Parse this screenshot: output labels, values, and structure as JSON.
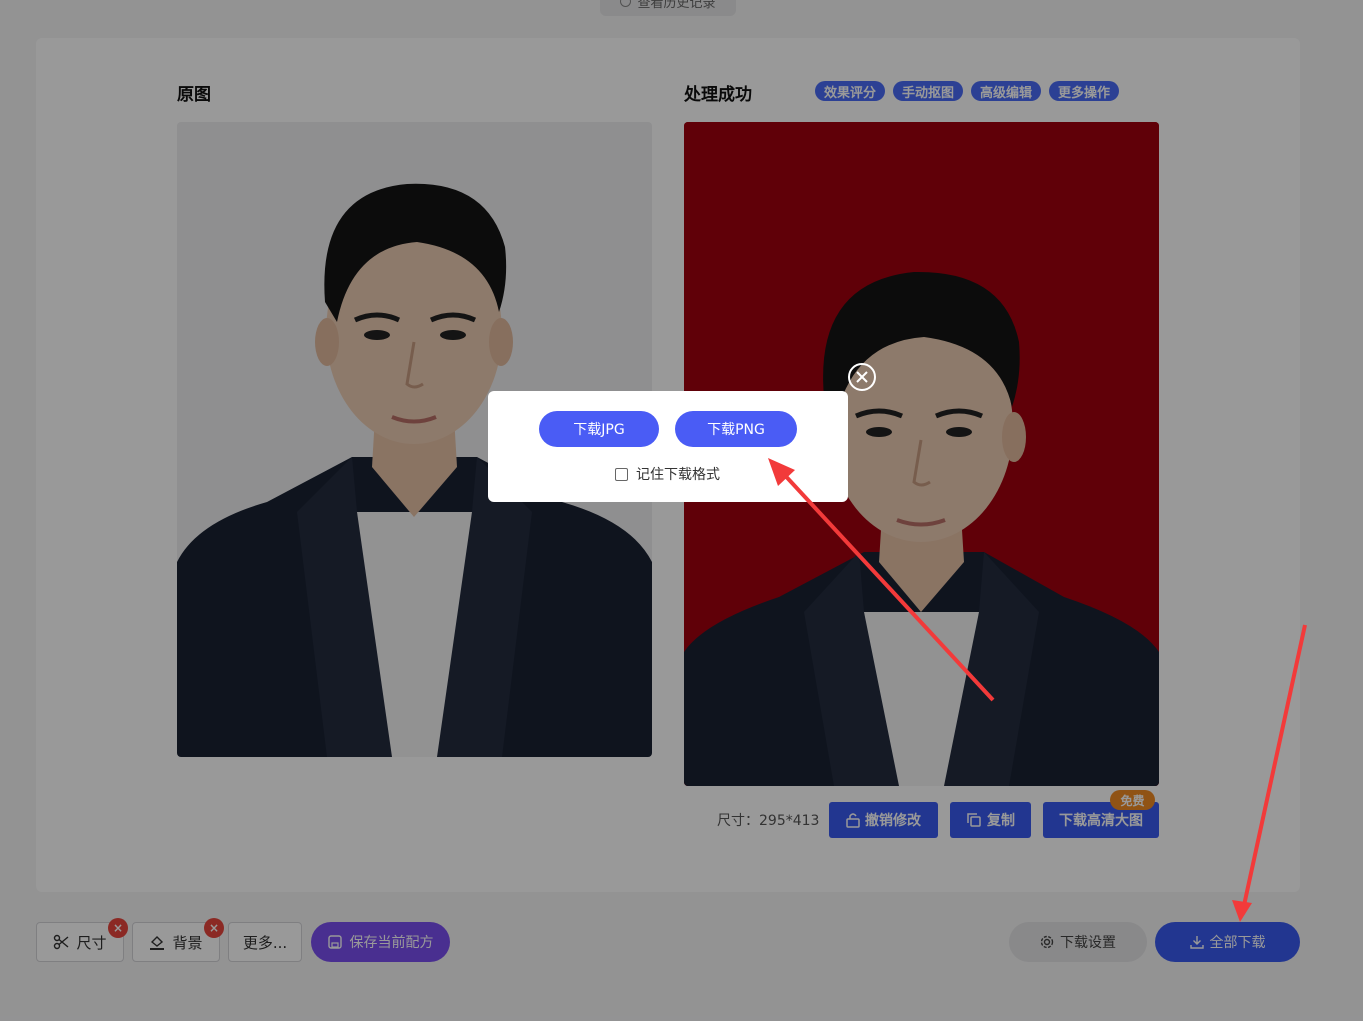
{
  "history": {
    "label": "查看历史记录",
    "icon": "clock-icon"
  },
  "original": {
    "title": "原图"
  },
  "result": {
    "title": "处理成功",
    "tags": [
      "效果评分",
      "手动抠图",
      "高级编辑",
      "更多操作"
    ],
    "background_color": "#a0000e"
  },
  "info": {
    "size_label": "尺寸：",
    "size_value": "295*413"
  },
  "actions": {
    "undo_label": "撤销修改",
    "copy_label": "复制",
    "hd_label": "下载高清大图",
    "free_badge": "免费"
  },
  "toolbar": {
    "size_label": "尺寸",
    "background_label": "背景",
    "more_label": "更多...",
    "save_recipe_label": "保存当前配方",
    "download_settings_label": "下载设置",
    "download_all_label": "全部下载",
    "remove_mark": "×"
  },
  "dialog": {
    "jpg_label": "下载JPG",
    "png_label": "下载PNG",
    "remember_label": "记住下载格式",
    "remember_checked": false
  },
  "colors": {
    "accent": "#3a5bf0",
    "purple": "#7b4ff0",
    "badge_orange": "#f08a24",
    "arrow_red": "#f23a3a"
  }
}
